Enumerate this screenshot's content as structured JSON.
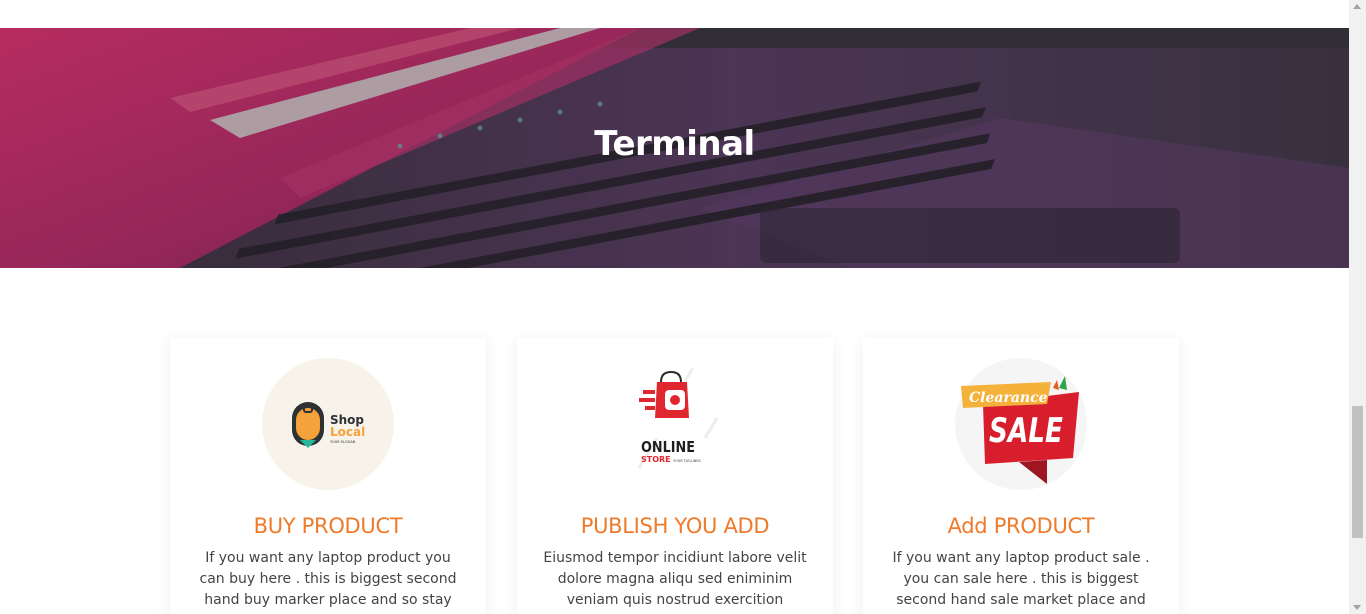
{
  "hero": {
    "title": "Terminal",
    "background": "laptop-keyboard-photo"
  },
  "cards": [
    {
      "title": "BUY PRODUCT",
      "description": "If you want any laptop product you can buy here . this is biggest second hand buy marker place and so stay with us",
      "logo": {
        "line1": "Shop",
        "line2": "Local",
        "tagline": "YOUR SLOGAN",
        "icon": "shopping-bag-pin-icon"
      }
    },
    {
      "title": "PUBLISH YOU ADD",
      "description": "Eiusmod tempor incidiunt labore velit dolore magna aliqu sed eniminim veniam quis nostrud exercition eullamco",
      "logo": {
        "line1": "ONLINE",
        "line2": "STORE",
        "tagline": "YOUR TAGLINES",
        "icon": "shopping-bag-icon"
      }
    },
    {
      "title": "Add PRODUCT",
      "description": "If you want any laptop product sale . you can sale here . this is biggest second hand sale market place and so stay with",
      "logo": {
        "line1": "Clearance",
        "line2": "SALE",
        "icon": "sale-ribbon-icon"
      }
    }
  ],
  "colors": {
    "accent": "#ef7a2a",
    "text": "#444444",
    "hero_overlay": "#302c34"
  }
}
